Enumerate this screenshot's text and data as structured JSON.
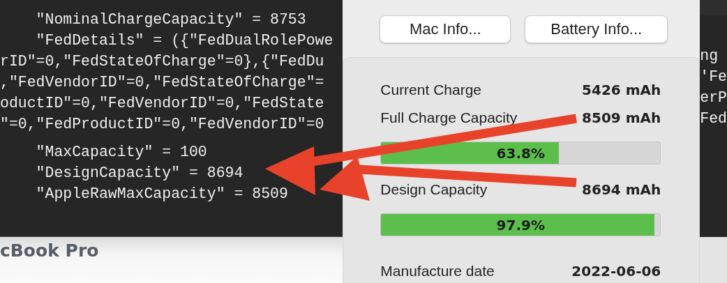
{
  "terminal": {
    "lines": [
      "    \"NominalChargeCapacity\" = 8753",
      "    \"FedDetails\" = ({\"FedDualRolePowe",
      "rID\"=0,\"FedStateOfCharge\"=0},{\"FedDu",
      ",\"FedVendorID\"=0,\"FedStateOfCharge\"=",
      "oductID\"=0,\"FedVendorID\"=0,\"FedState",
      "\"=0,\"FedProductID\"=0,\"FedVendorID\"=0",
      "    \"MaxCapacity\" = 100",
      "    \"DesignCapacity\" = 8694",
      "    \"AppleRawMaxCapacity\" = 8509"
    ]
  },
  "window_title": "cBook Pro",
  "right_terminal": {
    "lines": [
      "ng",
      "'Fe",
      "erP",
      "Fed"
    ]
  },
  "panel": {
    "buttons": [
      "Mac Info...",
      "Battery Info..."
    ],
    "rows": [
      {
        "kind": "value",
        "label": "Current Charge",
        "value": "5426 mAh"
      },
      {
        "kind": "value",
        "label": "Full Charge Capacity",
        "value": "8509 mAh"
      },
      {
        "kind": "bar",
        "level": 0.638,
        "reading": "63.8%"
      },
      {
        "kind": "value",
        "label": "Design Capacity",
        "value": "8694 mAh"
      },
      {
        "kind": "bar",
        "level": 0.979,
        "reading": "97.9%"
      },
      {
        "kind": "gap"
      },
      {
        "kind": "value",
        "label": "Manufacture date",
        "value": "2022-06-06"
      }
    ]
  }
}
